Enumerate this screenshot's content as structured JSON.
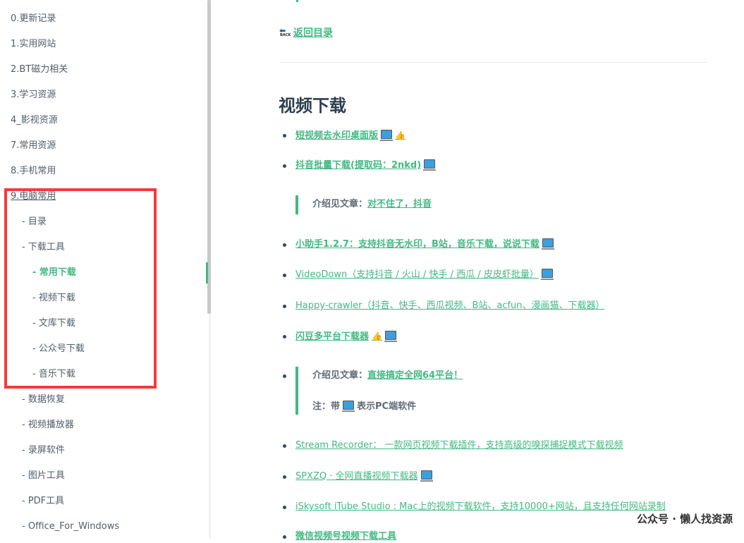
{
  "sidebar": {
    "items": [
      {
        "label": "0.更新记录"
      },
      {
        "label": "1.实用网站"
      },
      {
        "label": "2.BT磁力相关"
      },
      {
        "label": "3.学习资源"
      },
      {
        "label": "4_影视资源"
      },
      {
        "label": "7.常用资源"
      },
      {
        "label": "8.手机常用"
      },
      {
        "label": "9.电脑常用"
      },
      {
        "label": "- 目录"
      },
      {
        "label": "- 下载工具"
      },
      {
        "label": "- 常用下载"
      },
      {
        "label": "- 视频下载"
      },
      {
        "label": "- 文库下载"
      },
      {
        "label": "- 公众号下载"
      },
      {
        "label": "- 音乐下载"
      },
      {
        "label": "- 数据恢复"
      },
      {
        "label": "- 视频播放器"
      },
      {
        "label": "- 录屏软件"
      },
      {
        "label": "- 图片工具"
      },
      {
        "label": "- PDF工具"
      },
      {
        "label": "- Office_For_Windows"
      }
    ]
  },
  "content": {
    "back_icon_text": "BACK",
    "back_label": "返回目录",
    "section_title": "视频下载",
    "links": [
      {
        "text": "短视频去水印桌面版"
      },
      {
        "text": "抖音批量下载(提取码：2nkd)"
      },
      {
        "text": "小助手1.2.7：支持抖音无水印，B站，音乐下载，说说下载"
      },
      {
        "text": "VideoDown（支持抖音 / 火山 / 快手 / 西瓜 / 皮皮虾批量）"
      },
      {
        "text": "Happy-crawler（抖音、快手、西瓜视频、B站、acfun、漫画猫、下载器）"
      },
      {
        "text": "闪豆多平台下载器"
      },
      {
        "text": "Stream Recorder：  一款网页视频下载插件，支持高级的嗅探捕捉模式下载视频"
      },
      {
        "text": "SPXZQ · 全网直播视频下载器"
      },
      {
        "text": "iSkysoft iTube Studio : Mac上的视频下载软件，支持10000+网站，且支持任何网站录制"
      },
      {
        "text": "微信视频号视频下载工具"
      }
    ],
    "quote1": {
      "prefix": "介绍见文章：",
      "link": "对不住了，抖音"
    },
    "quote2": {
      "prefix": "介绍见文章：",
      "link": "直接搞定全网64平台！",
      "note_prefix": "注：带",
      "note_suffix": "表示PC端软件"
    },
    "thumb_icon": "thumbs-up-icon",
    "pc_icon": "computer-icon",
    "thumb_glyph": "👍"
  },
  "watermark": "公众号 · 懒人找资源",
  "colors": {
    "accent": "#42b983",
    "highlight": "#f53a3a",
    "text": "#34495e"
  }
}
